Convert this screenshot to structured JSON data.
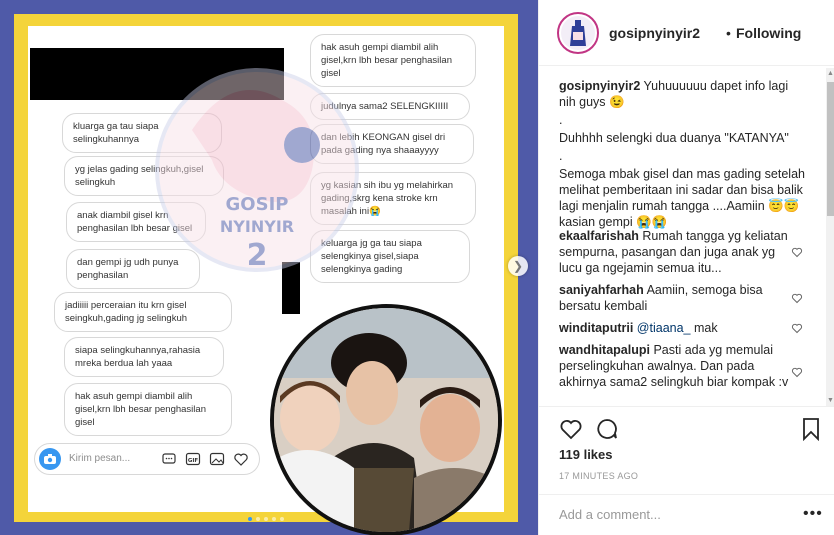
{
  "post": {
    "chat_left": [
      "kluarga ga tau siapa selingkuhannya",
      "yg jelas gading selingkuh,gisel selingkuh",
      "anak diambil gisel krn penghasilan lbh besar gisel",
      "dan gempi jg udh punya penghasilan",
      "jadiiiii perceraian itu krn gisel seingkuh,gading jg selingkuh",
      "siapa selingkuhannya,rahasia mreka berdua lah yaaa",
      "hak asuh gempi diambil alih gisel,krn lbh besar penghasilan gisel"
    ],
    "chat_right": [
      "hak asuh gempi diambil alih gisel,krn lbh besar penghasilan gisel",
      "judulnya sama2 SELENGKIIIII",
      "dan lebih KEONGAN gisel dri pada gading nya shaaayyyy",
      "yg kasian sih ibu yg melahirkan gading,skrg kena stroke krn masalah ini😭",
      "keluarga jg ga tau siapa selengkinya gisel,siapa selengkinya gading"
    ],
    "composer_placeholder": "Kirim pesan...",
    "watermark_line1": "GOSIP",
    "watermark_line2": "NYINYIR",
    "watermark_num": "2",
    "carousel_count": 5,
    "carousel_active": 0
  },
  "header": {
    "username": "gosipnyinyir2",
    "separator": "•",
    "follow_label": "Following"
  },
  "caption": {
    "username": "gosipnyinyir2",
    "line1": "Yuhuuuuuu dapet info lagi nih guys 😉",
    "line2": ".",
    "line3": "Duhhhh selengki dua duanya \"KATANYA\"",
    "line4": ".",
    "line5": "Semoga mbak gisel dan mas gading setelah melihat pemberitaan ini sadar dan bisa balik lagi menjalin rumah tangga ....Aamiin 😇😇 kasian gempi 😭😭"
  },
  "comments": [
    {
      "user": "ekaalfarishah",
      "text": "Rumah tangga yg keliatan sempurna, pasangan dan juga anak yg lucu ga ngejamin semua itu..."
    },
    {
      "user": "saniyahfarhah",
      "text": "Aamiin, semoga bisa bersatu kembali"
    },
    {
      "user": "winditaputrii",
      "mention": "@tiaana_",
      "text": "mak"
    },
    {
      "user": "wandhitapalupi",
      "text": "Pasti ada yg memulai perselingkuhan awalnya. Dan pada akhirnya sama2 selingkuh biar kompak :v"
    }
  ],
  "likes": "119 likes",
  "timestamp": "17 MINUTES AGO",
  "add_comment_placeholder": "Add a comment...",
  "more_label": "•••",
  "colors": {
    "frame_blue": "#4f5aa8",
    "frame_yellow": "#f4d43a",
    "link": "#003569",
    "accent": "#3897f0"
  }
}
